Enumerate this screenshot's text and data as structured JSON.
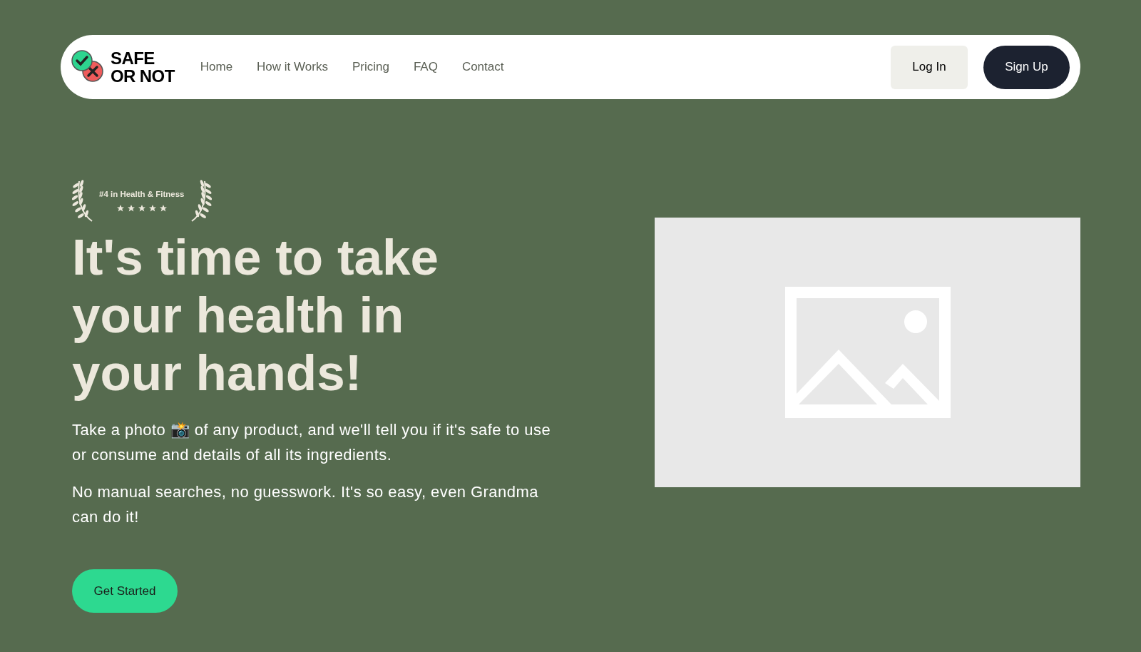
{
  "nav": {
    "logo": [
      "SAFE",
      "OR NOT"
    ],
    "links": [
      "Home",
      "How it Works",
      "Pricing",
      "FAQ",
      "Contact"
    ],
    "login": "Log In",
    "signup": "Sign Up"
  },
  "hero": {
    "award": {
      "text": "#4 in Health & Fitness",
      "stars": 5
    },
    "heading": "It's time to take your health in your hands!",
    "paragraphs": [
      "Take a photo 📸 of any product, and we'll tell you if it's safe to use or consume and details of all its ingredients.",
      "No manual searches, no guesswork. It's so easy, even Grandma can do it!"
    ],
    "cta": "Get Started"
  }
}
